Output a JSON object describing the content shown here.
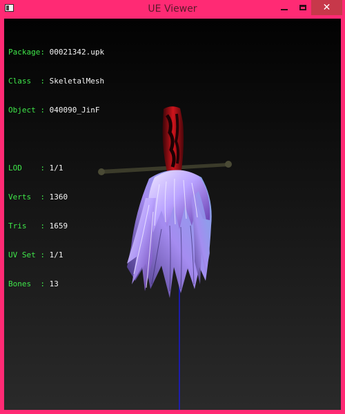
{
  "window": {
    "title": "UE Viewer"
  },
  "controls": {
    "minimize": "—",
    "maximize": "□",
    "close": "✕"
  },
  "info": {
    "package_label": "Package:",
    "package": "00021342.upk",
    "class_label": "Class  :",
    "class": "SkeletalMesh",
    "object_label": "Object :",
    "object": "040090_JinF",
    "lod_label": "LOD    :",
    "lod": "1/1",
    "verts_label": "Verts  :",
    "verts": "1360",
    "tris_label": "Tris   :",
    "tris": "1659",
    "uvset_label": "UV Set :",
    "uvset": "1/1",
    "bones_label": "Bones  :",
    "bones": "13"
  },
  "colors": {
    "frame": "#ff2a74",
    "label_green": "#3fe84a",
    "value_white": "#f5f5f5",
    "hair_light": "#d7ccff",
    "hair_dark": "#6a3fb0",
    "handle_red": "#c4161f",
    "axis_blue": "#1a1ad8"
  }
}
